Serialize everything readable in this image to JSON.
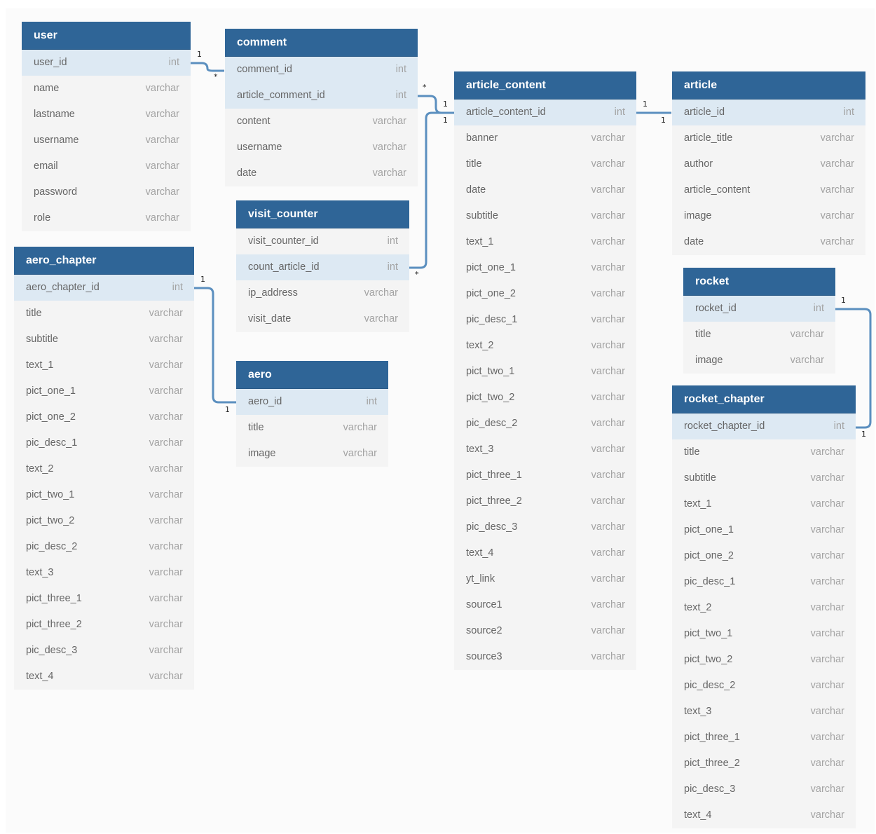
{
  "tables": {
    "user": {
      "name": "user",
      "fields": [
        {
          "name": "user_id",
          "type": "int",
          "pk": true
        },
        {
          "name": "name",
          "type": "varchar"
        },
        {
          "name": "lastname",
          "type": "varchar"
        },
        {
          "name": "username",
          "type": "varchar"
        },
        {
          "name": "email",
          "type": "varchar"
        },
        {
          "name": "password",
          "type": "varchar"
        },
        {
          "name": "role",
          "type": "varchar"
        }
      ]
    },
    "comment": {
      "name": "comment",
      "fields": [
        {
          "name": "comment_id",
          "type": "int",
          "pk": true
        },
        {
          "name": "article_comment_id",
          "type": "int",
          "pk": true
        },
        {
          "name": "content",
          "type": "varchar"
        },
        {
          "name": "username",
          "type": "varchar"
        },
        {
          "name": "date",
          "type": "varchar"
        }
      ]
    },
    "visit_counter": {
      "name": "visit_counter",
      "fields": [
        {
          "name": "visit_counter_id",
          "type": "int"
        },
        {
          "name": "count_article_id",
          "type": "int",
          "pk": true
        },
        {
          "name": "ip_address",
          "type": "varchar"
        },
        {
          "name": "visit_date",
          "type": "varchar"
        }
      ]
    },
    "aero_chapter": {
      "name": "aero_chapter",
      "fields": [
        {
          "name": "aero_chapter_id",
          "type": "int",
          "pk": true
        },
        {
          "name": "title",
          "type": "varchar"
        },
        {
          "name": "subtitle",
          "type": "varchar"
        },
        {
          "name": "text_1",
          "type": "varchar"
        },
        {
          "name": "pict_one_1",
          "type": "varchar"
        },
        {
          "name": "pict_one_2",
          "type": "varchar"
        },
        {
          "name": "pic_desc_1",
          "type": "varchar"
        },
        {
          "name": "text_2",
          "type": "varchar"
        },
        {
          "name": "pict_two_1",
          "type": "varchar"
        },
        {
          "name": "pict_two_2",
          "type": "varchar"
        },
        {
          "name": "pic_desc_2",
          "type": "varchar"
        },
        {
          "name": "text_3",
          "type": "varchar"
        },
        {
          "name": "pict_three_1",
          "type": "varchar"
        },
        {
          "name": "pict_three_2",
          "type": "varchar"
        },
        {
          "name": "pic_desc_3",
          "type": "varchar"
        },
        {
          "name": "text_4",
          "type": "varchar"
        }
      ]
    },
    "aero": {
      "name": "aero",
      "fields": [
        {
          "name": "aero_id",
          "type": "int",
          "pk": true
        },
        {
          "name": "title",
          "type": "varchar"
        },
        {
          "name": "image",
          "type": "varchar"
        }
      ]
    },
    "article_content": {
      "name": "article_content",
      "fields": [
        {
          "name": "article_content_id",
          "type": "int",
          "pk": true
        },
        {
          "name": "banner",
          "type": "varchar"
        },
        {
          "name": "title",
          "type": "varchar"
        },
        {
          "name": "date",
          "type": "varchar"
        },
        {
          "name": "subtitle",
          "type": "varchar"
        },
        {
          "name": "text_1",
          "type": "varchar"
        },
        {
          "name": "pict_one_1",
          "type": "varchar"
        },
        {
          "name": "pict_one_2",
          "type": "varchar"
        },
        {
          "name": "pic_desc_1",
          "type": "varchar"
        },
        {
          "name": "text_2",
          "type": "varchar"
        },
        {
          "name": "pict_two_1",
          "type": "varchar"
        },
        {
          "name": "pict_two_2",
          "type": "varchar"
        },
        {
          "name": "pic_desc_2",
          "type": "varchar"
        },
        {
          "name": "text_3",
          "type": "varchar"
        },
        {
          "name": "pict_three_1",
          "type": "varchar"
        },
        {
          "name": "pict_three_2",
          "type": "varchar"
        },
        {
          "name": "pic_desc_3",
          "type": "varchar"
        },
        {
          "name": "text_4",
          "type": "varchar"
        },
        {
          "name": "yt_link",
          "type": "varchar"
        },
        {
          "name": "source1",
          "type": "varchar"
        },
        {
          "name": "source2",
          "type": "varchar"
        },
        {
          "name": "source3",
          "type": "varchar"
        }
      ]
    },
    "article": {
      "name": "article",
      "fields": [
        {
          "name": "article_id",
          "type": "int",
          "pk": true
        },
        {
          "name": "article_title",
          "type": "varchar"
        },
        {
          "name": "author",
          "type": "varchar"
        },
        {
          "name": "article_content",
          "type": "varchar"
        },
        {
          "name": "image",
          "type": "varchar"
        },
        {
          "name": "date",
          "type": "varchar"
        }
      ]
    },
    "rocket": {
      "name": "rocket",
      "fields": [
        {
          "name": "rocket_id",
          "type": "int",
          "pk": true
        },
        {
          "name": "title",
          "type": "varchar"
        },
        {
          "name": "image",
          "type": "varchar"
        }
      ]
    },
    "rocket_chapter": {
      "name": "rocket_chapter",
      "fields": [
        {
          "name": "rocket_chapter_id",
          "type": "int",
          "pk": true
        },
        {
          "name": "title",
          "type": "varchar"
        },
        {
          "name": "subtitle",
          "type": "varchar"
        },
        {
          "name": "text_1",
          "type": "varchar"
        },
        {
          "name": "pict_one_1",
          "type": "varchar"
        },
        {
          "name": "pict_one_2",
          "type": "varchar"
        },
        {
          "name": "pic_desc_1",
          "type": "varchar"
        },
        {
          "name": "text_2",
          "type": "varchar"
        },
        {
          "name": "pict_two_1",
          "type": "varchar"
        },
        {
          "name": "pict_two_2",
          "type": "varchar"
        },
        {
          "name": "pic_desc_2",
          "type": "varchar"
        },
        {
          "name": "text_3",
          "type": "varchar"
        },
        {
          "name": "pict_three_1",
          "type": "varchar"
        },
        {
          "name": "pict_three_2",
          "type": "varchar"
        },
        {
          "name": "pic_desc_3",
          "type": "varchar"
        },
        {
          "name": "text_4",
          "type": "varchar"
        }
      ]
    }
  },
  "relationships": [
    {
      "from": "user.user_id",
      "to": "comment.comment_id",
      "from_card": "1",
      "to_card": "*"
    },
    {
      "from": "comment.article_comment_id",
      "to": "article_content.article_content_id",
      "from_card": "*",
      "to_card": "1"
    },
    {
      "from": "visit_counter.count_article_id",
      "to": "article_content.article_content_id",
      "from_card": "*",
      "to_card": "1"
    },
    {
      "from": "article_content.article_content_id",
      "to": "article.article_id",
      "from_card": "1",
      "to_card": "1"
    },
    {
      "from": "aero_chapter.aero_chapter_id",
      "to": "aero.aero_id",
      "from_card": "1",
      "to_card": "1"
    },
    {
      "from": "rocket.rocket_id",
      "to": "rocket_chapter.rocket_chapter_id",
      "from_card": "1",
      "to_card": "1"
    }
  ],
  "colors": {
    "header": "#2f6597",
    "pk_row": "#dde9f3",
    "body": "#f4f4f4",
    "link": "#5b8fbf"
  }
}
